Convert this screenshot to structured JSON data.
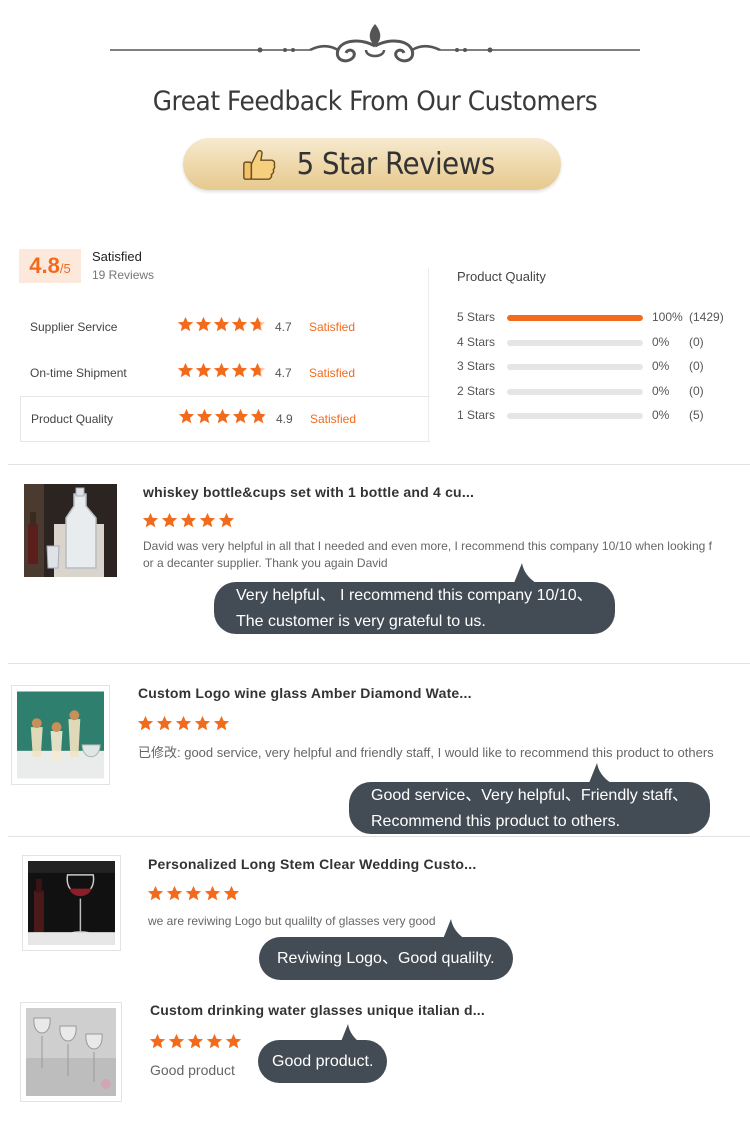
{
  "header": {
    "headline": "Great Feedback From Our Customers",
    "badge_text": "5 Star Reviews"
  },
  "summary": {
    "score": "4.8",
    "score_suffix": "/5",
    "status": "Satisfied",
    "reviews_count": "19 Reviews",
    "ratings": [
      {
        "label": "Supplier Service",
        "score": "4.7",
        "status": "Satisfied",
        "stars": 4.7
      },
      {
        "label": "On-time Shipment",
        "score": "4.7",
        "status": "Satisfied",
        "stars": 4.7
      },
      {
        "label": "Product Quality",
        "score": "4.9",
        "status": "Satisfied",
        "stars": 4.9
      }
    ]
  },
  "product_quality": {
    "title": "Product Quality",
    "rows": [
      {
        "label": "5  Stars",
        "fraction": 1.0,
        "percent": "100%",
        "count": "(1429)"
      },
      {
        "label": "4  Stars",
        "fraction": 0,
        "percent": "0%",
        "count": "(0)"
      },
      {
        "label": "3  Stars",
        "fraction": 0,
        "percent": "0%",
        "count": "(0)"
      },
      {
        "label": "2  Stars",
        "fraction": 0,
        "percent": "0%",
        "count": "(0)"
      },
      {
        "label": "1  Stars",
        "fraction": 0,
        "percent": "0%",
        "count": "(5)"
      }
    ]
  },
  "reviews": [
    {
      "title": "whiskey bottle&cups set with 1 bottle and 4 cu...",
      "stars": 5,
      "text_line1": "David was very helpful in all that I needed and even more, I recommend this company 10/10 when looking f",
      "text_line2": "or a decanter supplier. Thank you again David",
      "bubble_line1": "Very helpful、 I recommend this company 10/10、",
      "bubble_line2": "The customer is very grateful to us."
    },
    {
      "title": "Custom Logo wine glass Amber Diamond Wate...",
      "stars": 5,
      "text_line1": "已修改: good service, very helpful and friendly staff, I would like to recommend this product to others",
      "bubble_line1": "Good service、Very helpful、Friendly staff、",
      "bubble_line2": "Recommend this product to others."
    },
    {
      "title": "Personalized Long Stem Clear Wedding Custo...",
      "stars": 5,
      "text_line1": "we are reviwing Logo but qualilty of glasses very good",
      "bubble_line1": "Reviwing Logo、Good qualilty."
    },
    {
      "title": "Custom drinking water glasses unique italian d...",
      "stars": 5,
      "text_line1": "Good product",
      "bubble_line1": "Good product."
    }
  ],
  "colors": {
    "accent": "#f26b1d",
    "bubble": "#434b54",
    "star": "#f26b1d"
  }
}
